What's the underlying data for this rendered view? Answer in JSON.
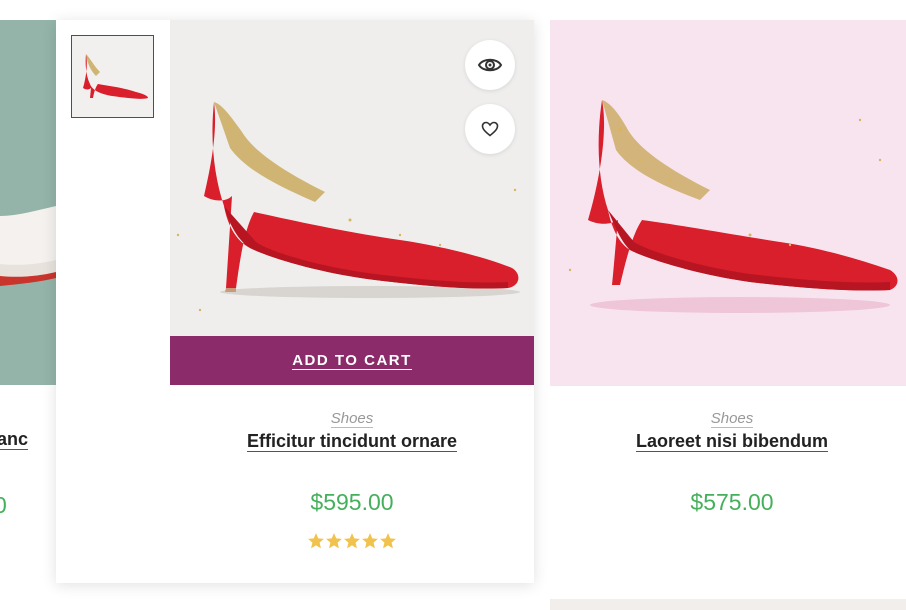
{
  "products": [
    {
      "id": "left",
      "title": "s blanc",
      "price": "0"
    },
    {
      "id": "center",
      "category": "Shoes",
      "title": "Efficitur tincidunt ornare",
      "price": "$595.00",
      "add_to_cart_label": "ADD TO CART",
      "rating_stars": 5,
      "quick_view_icon": "eye-icon",
      "wishlist_icon": "heart-icon"
    },
    {
      "id": "right",
      "category": "Shoes",
      "title": "Laoreet nisi bibendum",
      "price": "$575.00"
    }
  ],
  "colors": {
    "accent": "#8b2b6a",
    "price": "#45b05c",
    "star": "#f2c24e",
    "shoe_red": "#d8202c"
  }
}
